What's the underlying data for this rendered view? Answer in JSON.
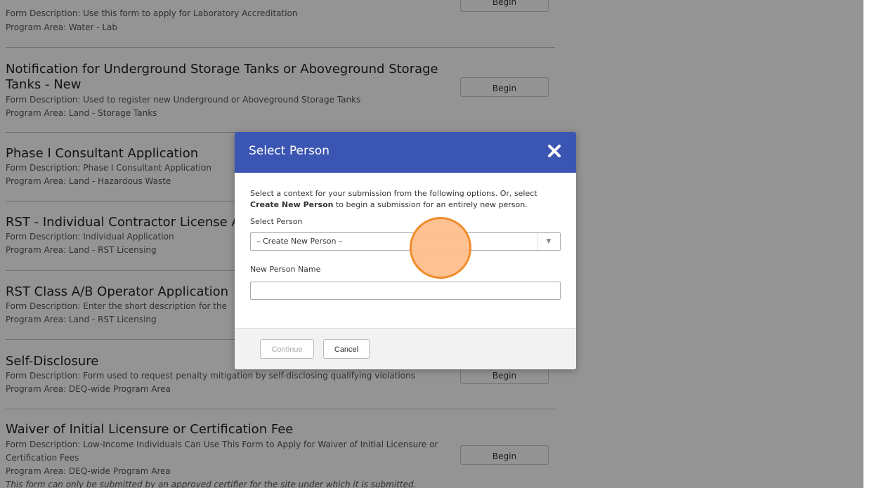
{
  "forms": [
    {
      "title": "",
      "description": "Form Description: Use this form to apply for Laboratory Accreditation",
      "program": "Program Area: Water - Lab",
      "button": "Begin"
    },
    {
      "title_line1": "Notification for Underground Storage Tanks or Aboveground Storage",
      "title_line2": "Tanks - New",
      "description": "Form Description: Used to register new Underground or Aboveground Storage Tanks",
      "program": "Program Area: Land - Storage Tanks",
      "button": "Begin"
    },
    {
      "title": "Phase I Consultant Application",
      "description": "Form Description: Phase I Consultant Application",
      "program": "Program Area: Land - Hazardous Waste"
    },
    {
      "title": "RST - Individual Contractor License Ap",
      "description": "Form Description: Individual Application",
      "program": "Program Area: Land - RST Licensing"
    },
    {
      "title": "RST Class A/B Operator Application",
      "description": "Form Description: Enter the short description for the",
      "program": "Program Area: Land - RST Licensing"
    },
    {
      "title": "Self-Disclosure",
      "description": "Form Description: Form used to request penalty mitigation by self-disclosing qualifying violations",
      "program": "Program Area: DEQ-wide Program Area",
      "button": "Begin"
    },
    {
      "title": "Waiver of Initial Licensure or Certification Fee",
      "description_line1": "Form Description: Low-Income Individuals Can Use This Form to Apply for Waiver of Initial Licensure or",
      "description_line2": "Certification Fees",
      "program": "Program Area: DEQ-wide Program Area",
      "note": "This form can only be submitted by an approved certifier for the site under which it is submitted.",
      "button": "Begin"
    }
  ],
  "modal": {
    "title": "Select Person",
    "intro_prefix": "Select a context for your submission from the following options. Or, select",
    "intro_bold": "Create New Person",
    "intro_suffix": " to begin a submission for an entirely new person.",
    "select_label": "Select Person",
    "select_value": "– Create New Person –",
    "name_label": "New Person Name",
    "name_value": "",
    "continue_label": "Continue",
    "cancel_label": "Cancel",
    "header_color": "#3b55b3"
  },
  "icons": {
    "close": "close-icon",
    "dropdown": "chevron-down-icon"
  }
}
